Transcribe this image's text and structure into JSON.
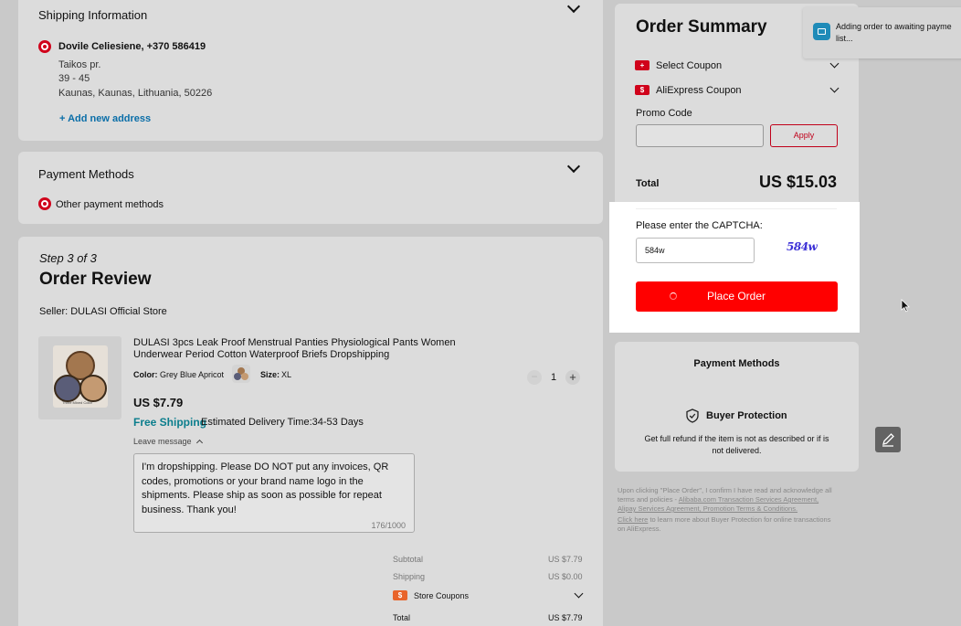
{
  "shipping": {
    "title": "Shipping Information",
    "name": "Dovile Celiesiene, +370 586419",
    "addr1": "Taikos pr.",
    "addr2": "39 - 45",
    "addr3": "Kaunas, Kaunas, Lithuania, 50226",
    "add_address": "+ Add new address"
  },
  "payment": {
    "title": "Payment Methods",
    "option": "Other payment methods"
  },
  "review": {
    "step": "Step 3 of 3",
    "title": "Order Review",
    "seller": "Seller: DULASI Official Store",
    "product_title_1": "DULASI 3pcs Leak Proof Menstrual Panties Physiological Pants Women",
    "product_title_2": "Underwear Period Cotton Waterproof Briefs Dropshipping",
    "color_label": "Color:",
    "color_value": "Grey Blue Apricot",
    "size_label": "Size:",
    "size_value": "XL",
    "quantity": "1",
    "price": "US $7.79",
    "free_shipping": "Free Shipping",
    "delivery": "Estimated Delivery Time:34-53 Days",
    "leave_message": "Leave message",
    "message": "I'm dropshipping. Please DO NOT put any invoices, QR codes, promotions or your brand name logo in the shipments. Please ship as soon as possible for repeat business. Thank you!",
    "char_count": "176/1000",
    "image_caption": "Three Mixed Color"
  },
  "totals": {
    "subtotal_label": "Subtotal",
    "subtotal_value": "US $7.79",
    "shipping_label": "Shipping",
    "shipping_value": "US $0.00",
    "store_coupons_label": "Store Coupons",
    "total_label": "Total",
    "total_value": "US $7.79"
  },
  "summary": {
    "title": "Order Summary",
    "select_coupon": "Select Coupon",
    "aliexpress_coupon": "AliExpress Coupon",
    "promo_label": "Promo Code",
    "promo_value": "",
    "apply": "Apply",
    "total_label": "Total",
    "total_value": "US $15.03",
    "captcha_label": "Please enter the CAPTCHA:",
    "captcha_value": "584w",
    "captcha_image_text": "584w",
    "place_order": "Place Order"
  },
  "side": {
    "payment_methods": "Payment Methods",
    "buyer_protection": "Buyer Protection",
    "protection_text_1": "Get full refund if the item is not as described or if is",
    "protection_text_2": "not delivered.",
    "legal_1": "Upon clicking \"Place Order\", I confirm I have read and acknowledge all",
    "legal_2a": "terms and policies -",
    "legal_2b": "Alibaba.com Transaction Services Agreement,",
    "legal_3": "Alipay Services Agreement, Promotion Terms & Conditions.",
    "legal_4a": "Click here",
    "legal_4b": "to learn more about Buyer Protection for online transactions",
    "legal_5": "on AliExpress."
  },
  "toast": {
    "text_1": "Adding order to awaiting payme",
    "text_2": "list..."
  },
  "colors": {
    "accent": "#ff0000",
    "brand_red": "#d0021b",
    "link": "#0a6ea8",
    "overlay_bg": "#c9c9c9"
  }
}
